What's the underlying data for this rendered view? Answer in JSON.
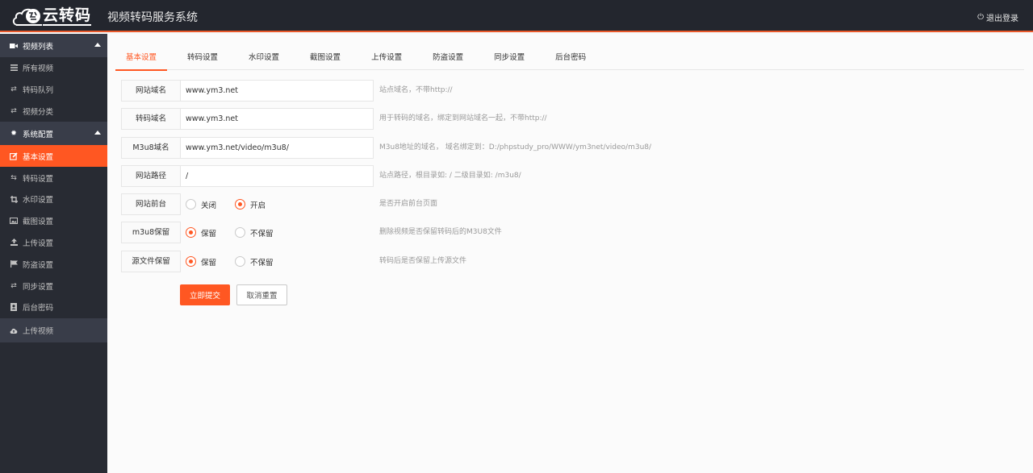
{
  "header": {
    "logo_text": "云转码",
    "title": "视频转码服务系统",
    "logout_icon": "power-icon",
    "logout_label": "退出登录"
  },
  "colors": {
    "accent": "#ff5722",
    "header_bg": "#23262e",
    "sidebar_bg": "#282b33",
    "sidebar_group_bg": "#393d49"
  },
  "sidebar": {
    "groups": [
      {
        "label": "视频列表",
        "icon": "video-camera-icon",
        "expanded": true,
        "items": [
          {
            "label": "所有视频",
            "icon": "list-icon"
          },
          {
            "label": "转码队列",
            "icon": "exchange-icon"
          },
          {
            "label": "视频分类",
            "icon": "exchange-icon"
          }
        ]
      },
      {
        "label": "系统配置",
        "icon": "gear-icon",
        "expanded": true,
        "items": [
          {
            "label": "基本设置",
            "icon": "edit-icon",
            "active": true
          },
          {
            "label": "转码设置",
            "icon": "retweet-icon"
          },
          {
            "label": "水印设置",
            "icon": "crop-icon"
          },
          {
            "label": "截图设置",
            "icon": "image-icon"
          },
          {
            "label": "上传设置",
            "icon": "upload-icon"
          },
          {
            "label": "防盗设置",
            "icon": "flag-icon"
          },
          {
            "label": "同步设置",
            "icon": "exchange-icon"
          },
          {
            "label": "后台密码",
            "icon": "user-card-icon"
          }
        ]
      }
    ],
    "upload": {
      "label": "上传视频",
      "icon": "cloud-upload-icon"
    }
  },
  "tabs": [
    {
      "label": "基本设置",
      "active": true
    },
    {
      "label": "转码设置"
    },
    {
      "label": "水印设置"
    },
    {
      "label": "截图设置"
    },
    {
      "label": "上传设置"
    },
    {
      "label": "防盗设置"
    },
    {
      "label": "同步设置"
    },
    {
      "label": "后台密码"
    }
  ],
  "form": {
    "fields": [
      {
        "label": "网站域名",
        "value": "www.ym3.net",
        "hint": "站点域名，不带http://"
      },
      {
        "label": "转码域名",
        "value": "www.ym3.net",
        "hint": "用于转码的域名，绑定到网站域名一起，不带http://"
      },
      {
        "label": "M3u8域名",
        "value": "www.ym3.net/video/m3u8/",
        "hint": "M3u8地址的域名， 域名绑定到：D:/phpstudy_pro/WWW/ym3net/video/m3u8/"
      },
      {
        "label": "网站路径",
        "value": "/",
        "hint": "站点路径，根目录如: / 二级目录如: /m3u8/"
      }
    ],
    "radios": [
      {
        "label": "网站前台",
        "options": [
          "关闭",
          "开启"
        ],
        "selected": "开启",
        "hint": "是否开启前台页面"
      },
      {
        "label": "m3u8保留",
        "options": [
          "保留",
          "不保留"
        ],
        "selected": "保留",
        "hint": "删除视频是否保留转码后的M3U8文件"
      },
      {
        "label": "源文件保留",
        "options": [
          "保留",
          "不保留"
        ],
        "selected": "保留",
        "hint": "转码后是否保留上传源文件"
      }
    ],
    "submit_label": "立即提交",
    "reset_label": "取消重置"
  }
}
